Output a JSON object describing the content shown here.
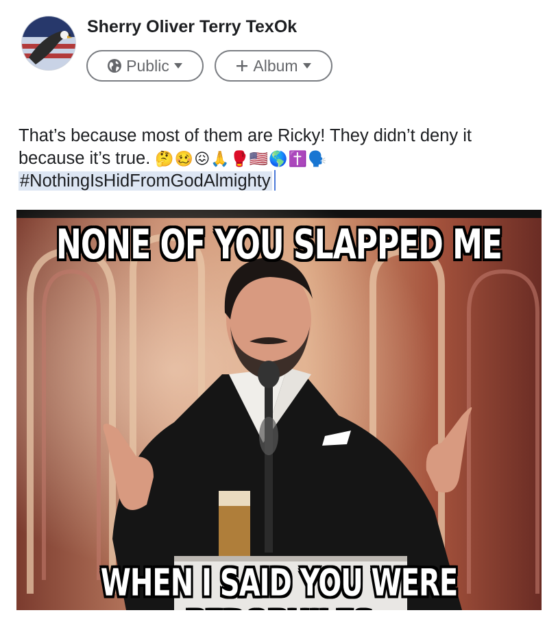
{
  "post": {
    "author_name": "Sherry Oliver Terry TexOk",
    "audience_label": "Public",
    "album_label": "Album",
    "text_line1": "That’s because most of them are Ricky! They didn’t deny it",
    "text_line2": "because it’s true.",
    "emojis": "🤔🥴😖🙏🥊🇺🇸🌎✝️🗣️",
    "hashtag": "#NothingIsHidFromGodAlmighty"
  },
  "meme": {
    "top_caption": "NONE OF YOU SLAPPED ME",
    "bottom_caption": "WHEN I SAID YOU WERE PEDOPHILES"
  },
  "icons": {
    "globe": "globe-icon",
    "dropdown": "caret-down-icon",
    "plus": "plus-icon"
  },
  "colors": {
    "pill_border": "#7a7d82",
    "pill_text": "#65676b",
    "hashtag_highlight": "#dde6f3",
    "cursor": "#4a79d8"
  }
}
